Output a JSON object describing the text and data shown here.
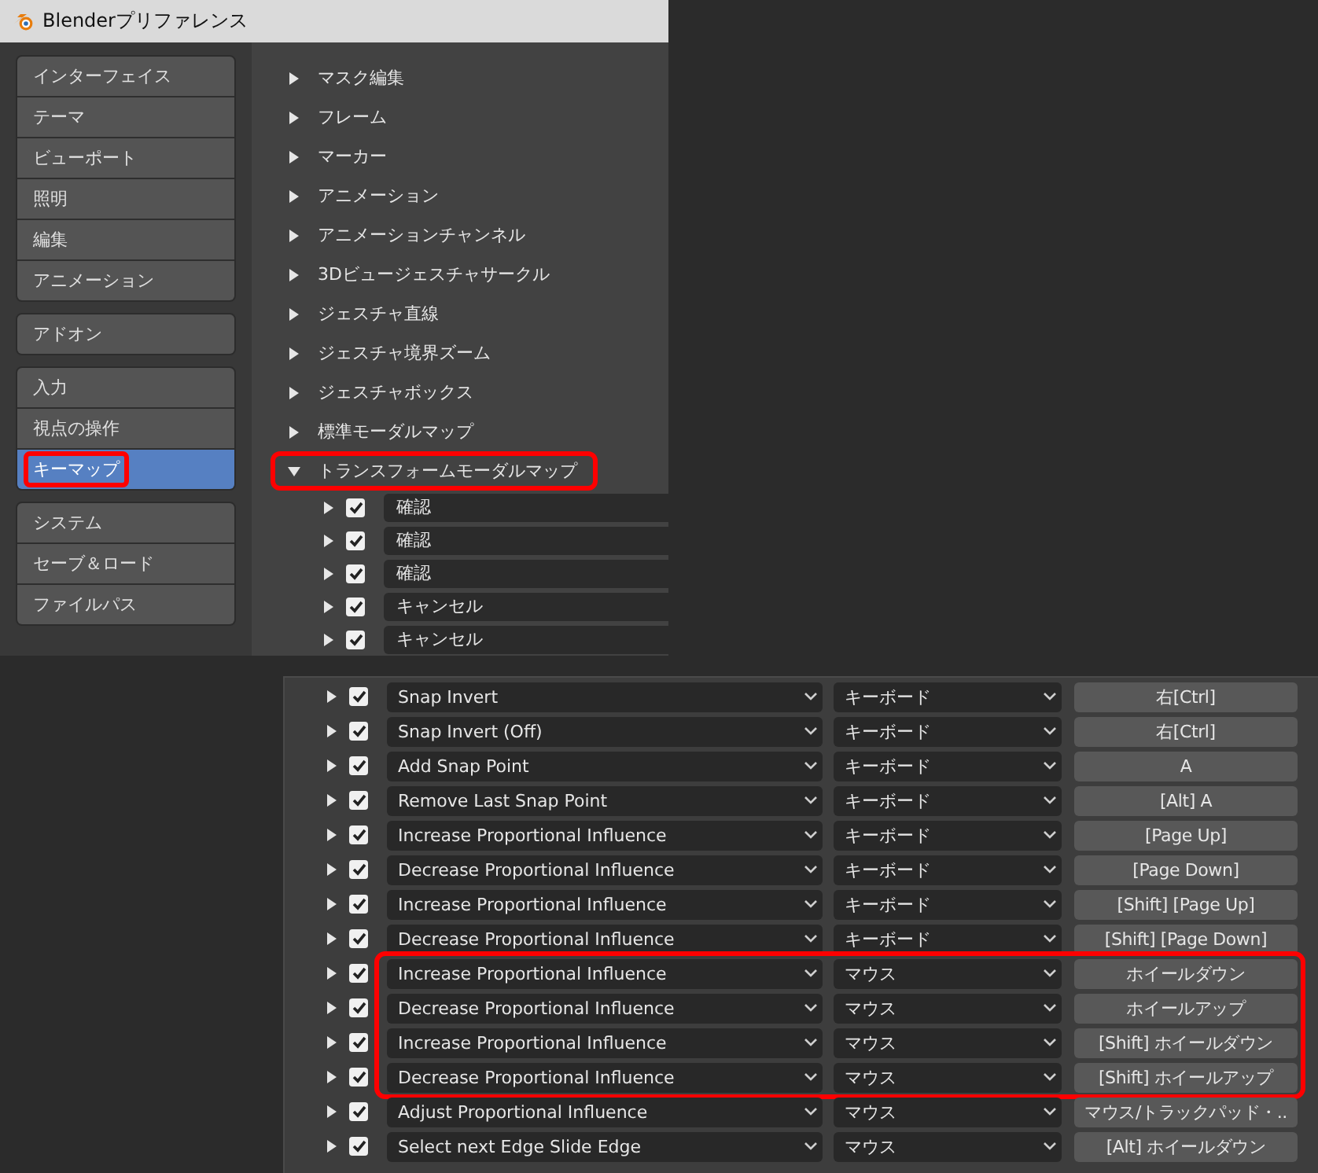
{
  "window": {
    "title": "Blenderプリファレンス"
  },
  "sidebar": {
    "groups": [
      {
        "items": [
          {
            "label": "インターフェイス",
            "selected": false,
            "highlighted": false
          },
          {
            "label": "テーマ",
            "selected": false,
            "highlighted": false
          },
          {
            "label": "ビューポート",
            "selected": false,
            "highlighted": false
          },
          {
            "label": "照明",
            "selected": false,
            "highlighted": false
          },
          {
            "label": "編集",
            "selected": false,
            "highlighted": false
          },
          {
            "label": "アニメーション",
            "selected": false,
            "highlighted": false
          }
        ]
      },
      {
        "items": [
          {
            "label": "アドオン",
            "selected": false,
            "highlighted": false
          }
        ]
      },
      {
        "items": [
          {
            "label": "入力",
            "selected": false,
            "highlighted": false
          },
          {
            "label": "視点の操作",
            "selected": false,
            "highlighted": false
          },
          {
            "label": "キーマップ",
            "selected": true,
            "highlighted": true
          }
        ]
      },
      {
        "items": [
          {
            "label": "システム",
            "selected": false,
            "highlighted": false
          },
          {
            "label": "セーブ＆ロード",
            "selected": false,
            "highlighted": false
          },
          {
            "label": "ファイルパス",
            "selected": false,
            "highlighted": false
          }
        ]
      }
    ]
  },
  "keymap_tree": [
    {
      "label": "マスク編集",
      "expanded": false,
      "highlighted": false
    },
    {
      "label": "フレーム",
      "expanded": false,
      "highlighted": false
    },
    {
      "label": "マーカー",
      "expanded": false,
      "highlighted": false
    },
    {
      "label": "アニメーション",
      "expanded": false,
      "highlighted": false
    },
    {
      "label": "アニメーションチャンネル",
      "expanded": false,
      "highlighted": false
    },
    {
      "label": "3Dビュージェスチャサークル",
      "expanded": false,
      "highlighted": false
    },
    {
      "label": "ジェスチャ直線",
      "expanded": false,
      "highlighted": false
    },
    {
      "label": "ジェスチャ境界ズーム",
      "expanded": false,
      "highlighted": false
    },
    {
      "label": "ジェスチャボックス",
      "expanded": false,
      "highlighted": false
    },
    {
      "label": "標準モーダルマップ",
      "expanded": false,
      "highlighted": false
    },
    {
      "label": "トランスフォームモーダルマップ",
      "expanded": true,
      "highlighted": true,
      "children": [
        {
          "label": "確認",
          "checked": true,
          "expanded": false
        },
        {
          "label": "確認",
          "checked": true,
          "expanded": false
        },
        {
          "label": "確認",
          "checked": true,
          "expanded": false
        },
        {
          "label": "キャンセル",
          "checked": true,
          "expanded": false
        },
        {
          "label": "キャンセル",
          "checked": true,
          "expanded": false
        }
      ]
    }
  ],
  "keymap_sections": [
    {
      "highlighted": false,
      "rows": [
        {
          "name": "Snap Invert",
          "input_type": "キーボード",
          "key": "右[Ctrl]",
          "checked": true,
          "expanded": false
        },
        {
          "name": "Snap Invert (Off)",
          "input_type": "キーボード",
          "key": "右[Ctrl]",
          "checked": true,
          "expanded": false
        },
        {
          "name": "Add Snap Point",
          "input_type": "キーボード",
          "key": "A",
          "checked": true,
          "expanded": false
        },
        {
          "name": "Remove Last Snap Point",
          "input_type": "キーボード",
          "key": "[Alt] A",
          "checked": true,
          "expanded": false
        },
        {
          "name": "Increase Proportional Influence",
          "input_type": "キーボード",
          "key": "[Page Up]",
          "checked": true,
          "expanded": false
        },
        {
          "name": "Decrease Proportional Influence",
          "input_type": "キーボード",
          "key": "[Page Down]",
          "checked": true,
          "expanded": false
        },
        {
          "name": "Increase Proportional Influence",
          "input_type": "キーボード",
          "key": "[Shift] [Page Up]",
          "checked": true,
          "expanded": false
        },
        {
          "name": "Decrease Proportional Influence",
          "input_type": "キーボード",
          "key": "[Shift] [Page Down]",
          "checked": true,
          "expanded": false
        }
      ]
    },
    {
      "highlighted": true,
      "rows": [
        {
          "name": "Increase Proportional Influence",
          "input_type": "マウス",
          "key": "ホイールダウン",
          "checked": true,
          "expanded": false
        },
        {
          "name": "Decrease Proportional Influence",
          "input_type": "マウス",
          "key": "ホイールアップ",
          "checked": true,
          "expanded": false
        },
        {
          "name": "Increase Proportional Influence",
          "input_type": "マウス",
          "key": "[Shift] ホイールダウン",
          "checked": true,
          "expanded": false
        },
        {
          "name": "Decrease Proportional Influence",
          "input_type": "マウス",
          "key": "[Shift] ホイールアップ",
          "checked": true,
          "expanded": false
        }
      ]
    },
    {
      "highlighted": false,
      "rows": [
        {
          "name": "Adjust Proportional Influence",
          "input_type": "マウス",
          "key": "マウス/トラックパッド・..",
          "checked": true,
          "expanded": false
        },
        {
          "name": "Select next Edge Slide Edge",
          "input_type": "マウス",
          "key": "[Alt] ホイールダウン",
          "checked": true,
          "expanded": false
        }
      ]
    }
  ]
}
